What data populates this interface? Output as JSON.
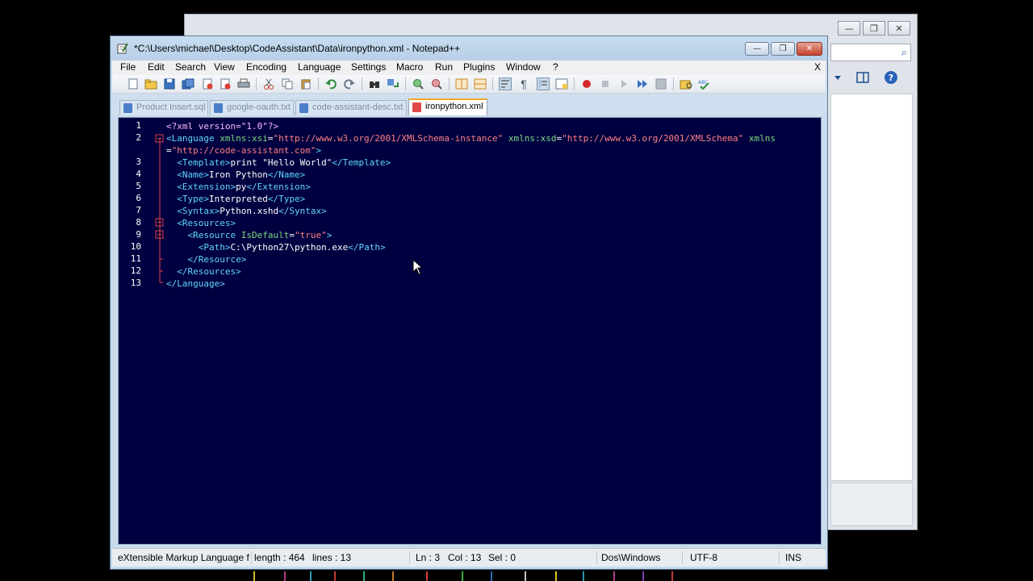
{
  "background_window": {
    "controls": [
      "—",
      "❒",
      "✕"
    ]
  },
  "window": {
    "title": "*C:\\Users\\michael\\Desktop\\CodeAssistant\\Data\\ironpython.xml - Notepad++",
    "controls": {
      "minimize": "—",
      "maximize": "❒",
      "close": "✕"
    }
  },
  "menu": {
    "items": [
      "File",
      "Edit",
      "Search",
      "View",
      "Encoding",
      "Language",
      "Settings",
      "Macro",
      "Run",
      "Plugins",
      "Window",
      "?"
    ],
    "close": "X"
  },
  "tabs": [
    {
      "label": "Product Insert.sql",
      "active": false
    },
    {
      "label": "google-oauth.txt",
      "active": false
    },
    {
      "label": "code-assistant-desc.txt",
      "active": false
    },
    {
      "label": "ironpython.xml",
      "active": true
    }
  ],
  "editor": {
    "line_numbers": [
      "1",
      "2",
      "",
      "3",
      "4",
      "5",
      "6",
      "7",
      "8",
      "9",
      "10",
      "11",
      "12",
      "13"
    ],
    "lines": [
      [
        {
          "t": "pi",
          "s": "<?xml version=\"1.0\"?>"
        }
      ],
      [
        {
          "t": "tag",
          "s": "<Language"
        },
        {
          "t": "attr",
          "s": " xmlns:xsi"
        },
        {
          "t": "txt",
          "s": "="
        },
        {
          "t": "val",
          "s": "\"http://www.w3.org/2001/XMLSchema-instance\""
        },
        {
          "t": "attr",
          "s": " xmlns:xsd"
        },
        {
          "t": "txt",
          "s": "="
        },
        {
          "t": "val",
          "s": "\"http://www.w3.org/2001/XMLSchema\""
        },
        {
          "t": "attr",
          "s": " xmlns"
        }
      ],
      [
        {
          "t": "txt",
          "s": "="
        },
        {
          "t": "val",
          "s": "\"http://code-assistant.com\""
        },
        {
          "t": "tag",
          "s": ">"
        }
      ],
      [
        {
          "t": "txt",
          "s": "  "
        },
        {
          "t": "tag",
          "s": "<Template>"
        },
        {
          "t": "txt",
          "s": "print \"Hello World\""
        },
        {
          "t": "tag",
          "s": "</Template>"
        }
      ],
      [
        {
          "t": "txt",
          "s": "  "
        },
        {
          "t": "tag",
          "s": "<Name>"
        },
        {
          "t": "txt",
          "s": "Iron Python"
        },
        {
          "t": "tag",
          "s": "</Name>"
        }
      ],
      [
        {
          "t": "txt",
          "s": "  "
        },
        {
          "t": "tag",
          "s": "<Extension>"
        },
        {
          "t": "txt",
          "s": "py"
        },
        {
          "t": "tag",
          "s": "</Extension>"
        }
      ],
      [
        {
          "t": "txt",
          "s": "  "
        },
        {
          "t": "tag",
          "s": "<Type>"
        },
        {
          "t": "txt",
          "s": "Interpreted"
        },
        {
          "t": "tag",
          "s": "</Type>"
        }
      ],
      [
        {
          "t": "txt",
          "s": "  "
        },
        {
          "t": "tag",
          "s": "<Syntax>"
        },
        {
          "t": "txt",
          "s": "Python.xshd"
        },
        {
          "t": "tag",
          "s": "</Syntax>"
        }
      ],
      [
        {
          "t": "txt",
          "s": "  "
        },
        {
          "t": "tag",
          "s": "<Resources>"
        }
      ],
      [
        {
          "t": "txt",
          "s": "    "
        },
        {
          "t": "tag",
          "s": "<Resource"
        },
        {
          "t": "attr",
          "s": " IsDefault"
        },
        {
          "t": "txt",
          "s": "="
        },
        {
          "t": "val",
          "s": "\"true\""
        },
        {
          "t": "tag",
          "s": ">"
        }
      ],
      [
        {
          "t": "txt",
          "s": "      "
        },
        {
          "t": "tag",
          "s": "<Path>"
        },
        {
          "t": "txt",
          "s": "C:\\Python27\\python.exe"
        },
        {
          "t": "tag",
          "s": "</Path>"
        }
      ],
      [
        {
          "t": "txt",
          "s": "    "
        },
        {
          "t": "tag",
          "s": "</Resource>"
        }
      ],
      [
        {
          "t": "txt",
          "s": "  "
        },
        {
          "t": "tag",
          "s": "</Resources>"
        }
      ],
      [
        {
          "t": "tag",
          "s": "</Language>"
        }
      ]
    ]
  },
  "status": {
    "file_type": "eXtensible Markup Language fi",
    "length": "length : 464",
    "lines": "lines : 13",
    "ln": "Ln : 3",
    "col": "Col : 13",
    "sel": "Sel : 0",
    "eol": "Dos\\Windows",
    "encoding": "UTF-8",
    "mode": "INS"
  },
  "colors": {
    "editor_bg": "#000040",
    "tag": "#5fd7ff",
    "attr": "#7fd97f",
    "value": "#ff7f7f",
    "text": "#ffffff",
    "fold_marker": "#e04040",
    "active_tab_accent": "#f5a623"
  }
}
